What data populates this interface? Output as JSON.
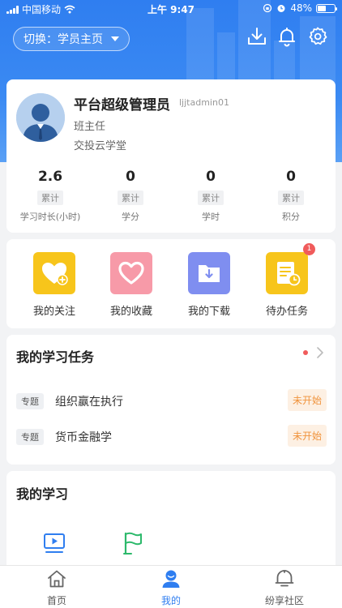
{
  "status_bar": {
    "carrier": "中国移动",
    "time": "上午 9:47",
    "battery": "48%",
    "battery_level": 0.48
  },
  "header": {
    "switch_label": "切换：学员主页",
    "icons": [
      "download-icon",
      "bell-icon",
      "settings-icon"
    ]
  },
  "profile": {
    "name": "平台超级管理员",
    "user_id": "ljjtadmin01",
    "role": "班主任",
    "org": "交投云学堂",
    "stats": [
      {
        "value": "2.6",
        "tag": "累计",
        "label": "学习时长(小时)"
      },
      {
        "value": "0",
        "tag": "累计",
        "label": "学分"
      },
      {
        "value": "0",
        "tag": "累计",
        "label": "学时"
      },
      {
        "value": "0",
        "tag": "累计",
        "label": "积分"
      }
    ]
  },
  "quick_links": [
    {
      "label": "我的关注",
      "color": "#f7c51b"
    },
    {
      "label": "我的收藏",
      "color": "#f79aa8"
    },
    {
      "label": "我的下载",
      "color": "#7f8ef0"
    },
    {
      "label": "待办任务",
      "color": "#f7c51b",
      "badge": "1"
    }
  ],
  "tasks": {
    "title": "我的学习任务",
    "items": [
      {
        "tag": "专题",
        "name": "组织赢在执行",
        "status": "未开始"
      },
      {
        "tag": "专题",
        "name": "货币金融学",
        "status": "未开始"
      }
    ]
  },
  "my_study": {
    "title": "我的学习"
  },
  "tabbar": [
    {
      "label": "首页",
      "active": false
    },
    {
      "label": "我的",
      "active": true
    },
    {
      "label": "纷享社区",
      "active": false
    }
  ],
  "colors": {
    "brand": "#2f7ef0",
    "warning": "#f0933c",
    "badge": "#f05b5b"
  }
}
